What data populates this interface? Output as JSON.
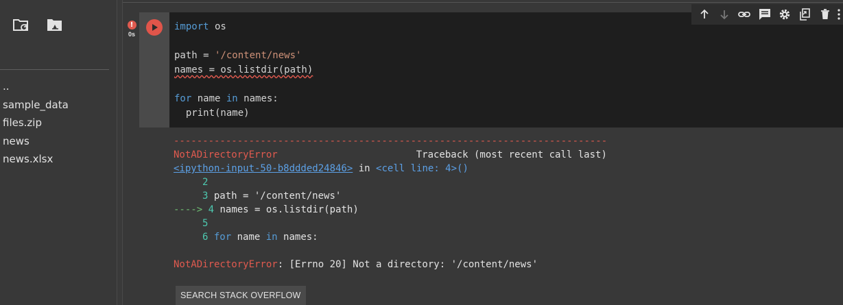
{
  "file_panel": {
    "buttons": [
      {
        "icon": "folder-refresh-icon"
      },
      {
        "icon": "drive-folder-icon"
      }
    ],
    "files": [
      "..",
      "sample_data",
      "files.zip",
      "news",
      "news.xlsx"
    ]
  },
  "cell": {
    "status": {
      "error_badge": "!",
      "exec_time": "0s"
    },
    "code_lines": [
      "import os",
      "",
      "path = '/content/news'",
      "names = os.listdir(path)",
      "",
      "for name in names:",
      "  print(name)"
    ],
    "toolbar": [
      "arrow-up-icon",
      "arrow-down-icon",
      "link-icon",
      "comment-icon",
      "settings-icon",
      "mirror-cell-icon",
      "delete-icon",
      "more-icon"
    ]
  },
  "output": {
    "separator": "---------------------------------------------------------------------------",
    "error_name": "NotADirectoryError",
    "traceback_label": "Traceback (most recent call last)",
    "input_link": "<ipython-input-50-b8ddded24846>",
    "in_text": "in",
    "cell_line": "<cell line: 4>()",
    "lines": [
      {
        "arrow": "",
        "num": "2",
        "code": ""
      },
      {
        "arrow": "",
        "num": "3",
        "code": "path = '/content/news'"
      },
      {
        "arrow": "---->",
        "num": "4",
        "code": "names = os.listdir(path)"
      },
      {
        "arrow": "",
        "num": "5",
        "code": ""
      },
      {
        "arrow": "",
        "num": "6",
        "code": "for name in names:"
      }
    ],
    "error_message": ": [Errno 20] Not a directory: '/content/news'",
    "so_button": "SEARCH STACK OVERFLOW"
  }
}
